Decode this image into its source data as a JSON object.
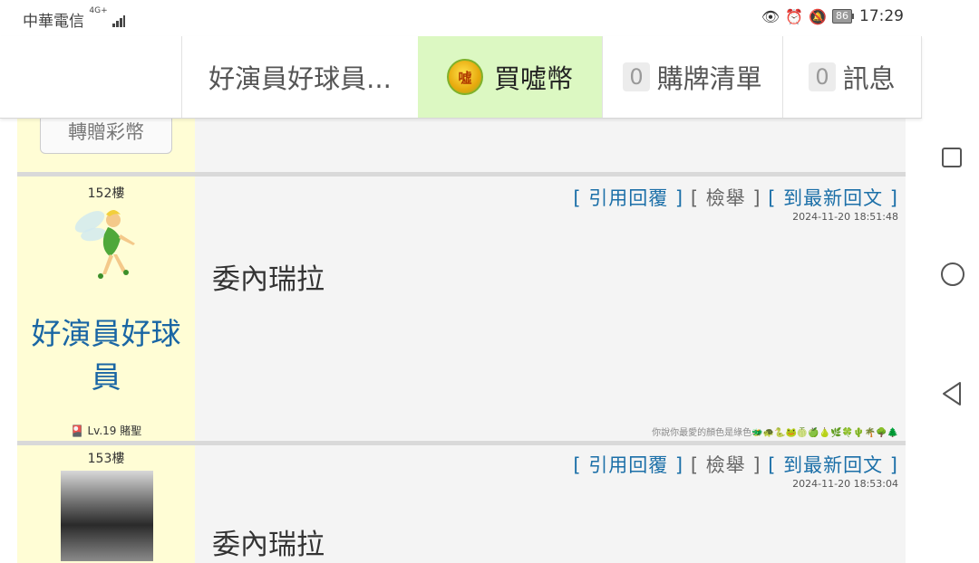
{
  "status_bar": {
    "carrier": "中華電信",
    "network": "4G+",
    "battery": "86",
    "time": "17:29",
    "icons": [
      "eye-comfort-icon",
      "alarm-icon",
      "mute-icon"
    ]
  },
  "topnav": {
    "tabs": [
      {
        "label": "好演員好球員..."
      },
      {
        "label": "買噓幣",
        "coin_text": "噓",
        "active": true
      },
      {
        "label": "購牌清單",
        "count": "0"
      },
      {
        "label": "訊息",
        "count": "0"
      }
    ]
  },
  "prev_post": {
    "gift_button": "轉贈彩幣"
  },
  "posts": [
    {
      "floor": "152樓",
      "actions": {
        "quote": "[ 引用回覆 ]",
        "report": "[ 檢舉 ]",
        "latest": "[ 到最新回文 ]"
      },
      "timestamp": "2024-11-20 18:51:48",
      "body": "委內瑞拉",
      "username": "好演員好球員",
      "level": "Lv.19 賭聖",
      "signature": "你說你最愛的顏色是綠色🐲🐢🐍🐸🍈🍏🍐🌿🍀🌵🌴🌳🌲"
    },
    {
      "floor": "153樓",
      "actions": {
        "quote": "[ 引用回覆 ]",
        "report": "[ 檢舉 ]",
        "latest": "[ 到最新回文 ]"
      },
      "timestamp": "2024-11-20 18:53:04",
      "body": "委內瑞拉"
    }
  ]
}
